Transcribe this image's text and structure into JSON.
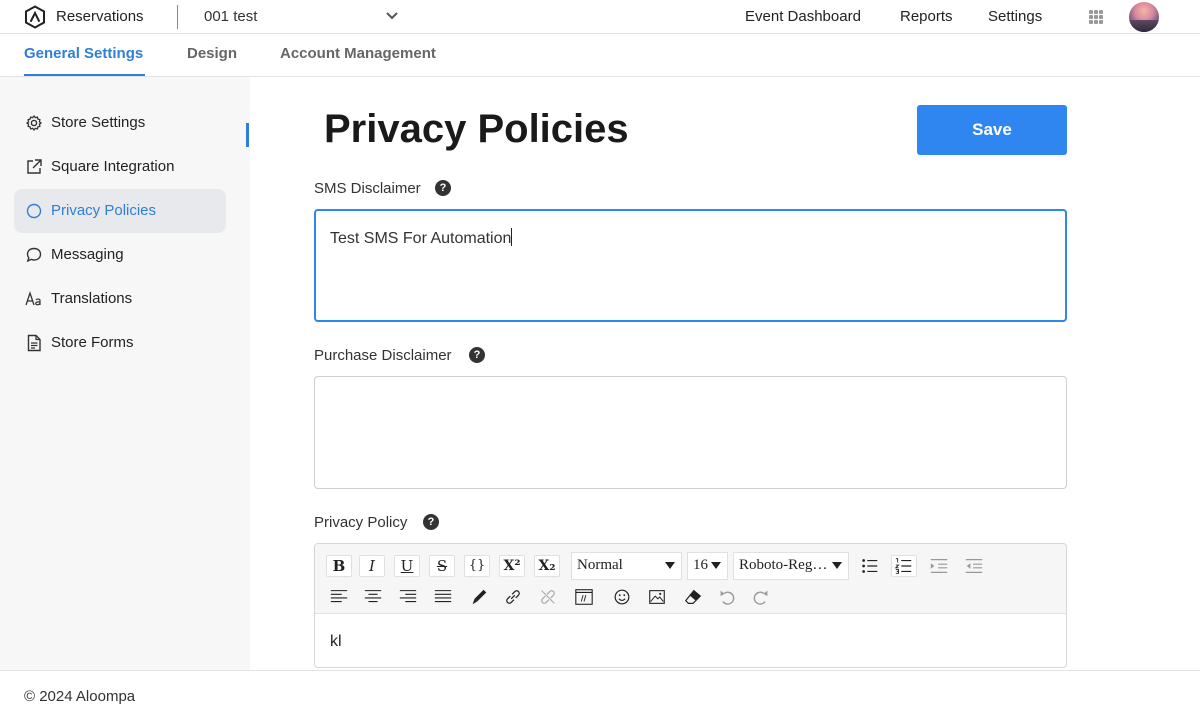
{
  "header": {
    "app_title": "Reservations",
    "store_name": "001 test",
    "nav": [
      "Event Dashboard",
      "Reports",
      "Settings"
    ]
  },
  "tabs": [
    {
      "label": "General Settings",
      "active": true
    },
    {
      "label": "Design",
      "active": false
    },
    {
      "label": "Account Management",
      "active": false
    }
  ],
  "sidebar": {
    "items": [
      {
        "label": "Store Settings",
        "icon": "gear-icon",
        "active": false
      },
      {
        "label": "Square Integration",
        "icon": "external-link-icon",
        "active": false
      },
      {
        "label": "Privacy Policies",
        "icon": "circle-icon",
        "active": true
      },
      {
        "label": "Messaging",
        "icon": "chat-bubble-icon",
        "active": false
      },
      {
        "label": "Translations",
        "icon": "font-icon",
        "active": false
      },
      {
        "label": "Store Forms",
        "icon": "document-icon",
        "active": false
      }
    ]
  },
  "main": {
    "title": "Privacy Policies",
    "save_label": "Save",
    "fields": {
      "sms": {
        "label": "SMS Disclaimer",
        "help": "?",
        "value": "Test SMS For Automation"
      },
      "purchase": {
        "label": "Purchase Disclaimer",
        "help": "?",
        "value": ""
      },
      "privacy": {
        "label": "Privacy Policy",
        "help": "?",
        "value": "kl"
      }
    },
    "editor": {
      "block_format": "Normal",
      "font_size": "16",
      "font_family": "Roboto-Reg…"
    }
  },
  "footer": {
    "copyright": "© 2024 Aloompa"
  },
  "colors": {
    "accent": "#2f86f0",
    "accent_text": "#2f7fd8",
    "sidebar_bg": "#f7f7f8"
  }
}
